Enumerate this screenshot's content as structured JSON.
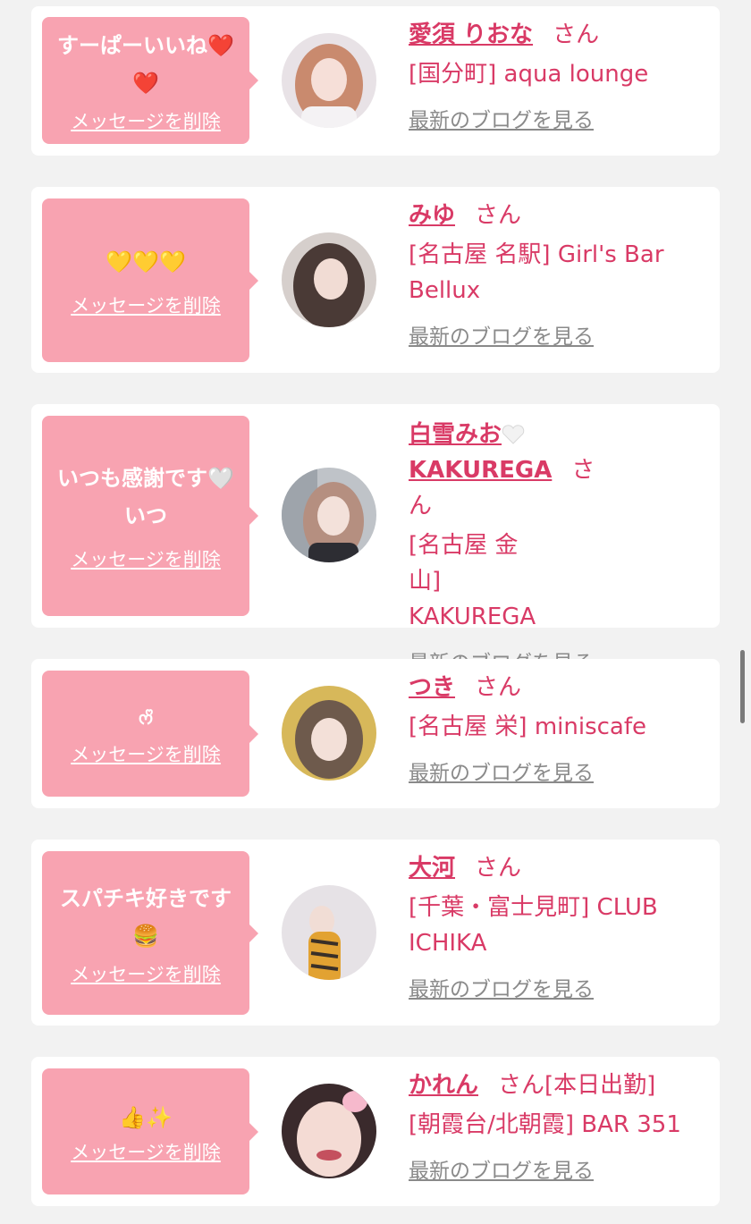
{
  "cards": [
    {
      "message": "すーぱーいいね❤️❤️",
      "delete_label": "メッセージを削除",
      "name": "愛須 りおな",
      "honorific": "さん",
      "shop": "[国分町] aqua lounge",
      "blog_label": "最新のブログを見る"
    },
    {
      "message": "💛💛💛",
      "delete_label": "メッセージを削除",
      "name": "みゆ",
      "honorific": "さん",
      "shop": "[名古屋 名駅] Girl's Bar Bellux",
      "blog_label": "最新のブログを見る"
    },
    {
      "message": "いつも感謝です🤍いつ",
      "delete_label": "メッセージを削除",
      "name_part1": "白雪みお",
      "name_part2": "KAKUREGA",
      "honorific": "さん",
      "shop": "[名古屋 金山] KAKUREGA",
      "blog_label": "最新のブログを見る"
    },
    {
      "message": "ᰔᩚ",
      "delete_label": "メッセージを削除",
      "name": "つき",
      "honorific": "さん",
      "shop": "[名古屋 栄] miniscafe",
      "blog_label": "最新のブログを見る"
    },
    {
      "message": "スパチキ好きです🍔",
      "delete_label": "メッセージを削除",
      "name": "大河",
      "honorific": "さん",
      "shop": "[千葉・富士見町] CLUB ICHIKA",
      "blog_label": "最新のブログを見る"
    },
    {
      "message": "👍✨",
      "delete_label": "メッセージを削除",
      "name": "かれん",
      "honorific": "さん[本日出勤]",
      "shop": "[朝霞台/北朝霞] BAR 351",
      "blog_label": "最新のブログを見る"
    }
  ],
  "colors": {
    "accent": "#d93a66",
    "bubble": "#f8a3b1",
    "background": "#f2f2f2",
    "muted": "#8a8a8a"
  }
}
